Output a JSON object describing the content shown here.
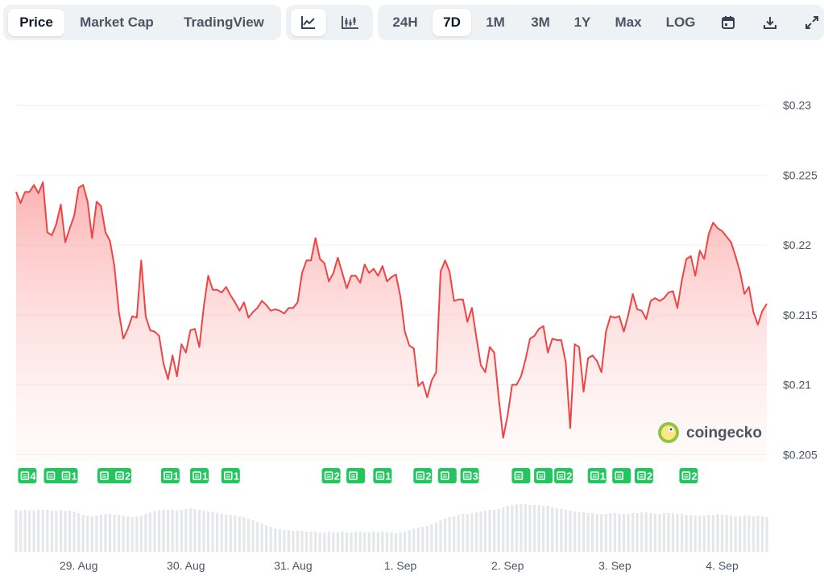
{
  "toolbar": {
    "metric_tabs": [
      "Price",
      "Market Cap",
      "TradingView"
    ],
    "active_metric": "Price",
    "chart_types": [
      "line-chart-icon",
      "candlestick-icon"
    ],
    "ranges": [
      "24H",
      "7D",
      "1M",
      "3M",
      "1Y",
      "Max",
      "LOG"
    ],
    "active_range": "7D",
    "actions": [
      "calendar-icon",
      "download-icon",
      "expand-icon"
    ]
  },
  "watermark": "coingecko",
  "colors": {
    "line": "#ef4444",
    "fill_top": "#fca5a5",
    "news": "#22c55e",
    "volume": "#e5e7eb",
    "grid": "#eef0f3"
  },
  "chart_data": {
    "type": "area",
    "title": "",
    "xlabel": "",
    "ylabel": "",
    "ylim": [
      0.2045,
      0.2335
    ],
    "y_ticks": [
      "$0.205",
      "$0.21",
      "$0.215",
      "$0.22",
      "$0.225",
      "$0.23"
    ],
    "y_tick_values": [
      0.205,
      0.21,
      0.215,
      0.22,
      0.225,
      0.23
    ],
    "x_range": [
      0,
      168
    ],
    "x_ticks": [
      "29. Aug",
      "30. Aug",
      "31. Aug",
      "1. Sep",
      "2. Sep",
      "3. Sep",
      "4. Sep"
    ],
    "x_tick_values": [
      14,
      38,
      62,
      86,
      110,
      134,
      158
    ],
    "grid": true,
    "series": [
      {
        "x": [
          0,
          1,
          2,
          3,
          4,
          5,
          6,
          7,
          8,
          9,
          10,
          11,
          12,
          13,
          14,
          15,
          16,
          17,
          18,
          19,
          20,
          21,
          22,
          23,
          24,
          25,
          26,
          27,
          28,
          29,
          30,
          31,
          32,
          33,
          34,
          35,
          36,
          37,
          38,
          39,
          40,
          41,
          42,
          43,
          44,
          45,
          46,
          47,
          48,
          49,
          50,
          51,
          52,
          53,
          54,
          55,
          56,
          57,
          58,
          59,
          60,
          61,
          62,
          63,
          64,
          65,
          66,
          67,
          68,
          69,
          70,
          71,
          72,
          73,
          74,
          75,
          76,
          77,
          78,
          79,
          80,
          81,
          82,
          83,
          84,
          85,
          86,
          87,
          88,
          89,
          90,
          91,
          92,
          93,
          94,
          95,
          96,
          97,
          98,
          99,
          100,
          101,
          102,
          103,
          104,
          105,
          106,
          107,
          108,
          109,
          110,
          111,
          112,
          113,
          114,
          115,
          116,
          117,
          118,
          119,
          120,
          121,
          122,
          123,
          124,
          125,
          126,
          127,
          128,
          129,
          130,
          131,
          132,
          133,
          134,
          135,
          136,
          137,
          138,
          139,
          140,
          141,
          142,
          143,
          144,
          145,
          146,
          147,
          148,
          149,
          150,
          151,
          152,
          153,
          154,
          155,
          156,
          157,
          158,
          159,
          160,
          161,
          162,
          163,
          164,
          165,
          166,
          167,
          168
        ],
        "values": [
          0.2238,
          0.223,
          0.2238,
          0.2238,
          0.2243,
          0.2237,
          0.2245,
          0.2209,
          0.2207,
          0.2215,
          0.2229,
          0.2202,
          0.2212,
          0.2221,
          0.2241,
          0.2243,
          0.2231,
          0.2205,
          0.2231,
          0.2228,
          0.2209,
          0.2203,
          0.2185,
          0.2152,
          0.2133,
          0.214,
          0.2149,
          0.2148,
          0.2189,
          0.2149,
          0.2139,
          0.2138,
          0.2135,
          0.2115,
          0.2104,
          0.2121,
          0.2106,
          0.2129,
          0.2123,
          0.2139,
          0.214,
          0.2127,
          0.2156,
          0.2178,
          0.2168,
          0.2168,
          0.2166,
          0.217,
          0.2164,
          0.2159,
          0.2153,
          0.2159,
          0.2148,
          0.2152,
          0.2155,
          0.216,
          0.2157,
          0.2153,
          0.2154,
          0.2153,
          0.2151,
          0.2155,
          0.2155,
          0.2159,
          0.218,
          0.2189,
          0.2189,
          0.2205,
          0.219,
          0.2187,
          0.2174,
          0.218,
          0.2191,
          0.218,
          0.2169,
          0.2178,
          0.2178,
          0.2173,
          0.2186,
          0.218,
          0.2183,
          0.2178,
          0.2185,
          0.2174,
          0.2177,
          0.2179,
          0.2163,
          0.2138,
          0.2128,
          0.2126,
          0.2099,
          0.2102,
          0.2091,
          0.2103,
          0.2109,
          0.2181,
          0.2189,
          0.2181,
          0.216,
          0.2161,
          0.2161,
          0.2145,
          0.2155,
          0.2134,
          0.2114,
          0.2109,
          0.2127,
          0.2123,
          0.2091,
          0.2062,
          0.2078,
          0.21,
          0.21,
          0.2106,
          0.2118,
          0.2133,
          0.2135,
          0.214,
          0.2142,
          0.2123,
          0.2133,
          0.2132,
          0.2132,
          0.2116,
          0.2069,
          0.2129,
          0.2127,
          0.2095,
          0.2119,
          0.2121,
          0.2117,
          0.2109,
          0.2138,
          0.2149,
          0.2148,
          0.2149,
          0.2138,
          0.215,
          0.2165,
          0.2154,
          0.2153,
          0.2147,
          0.216,
          0.2162,
          0.216,
          0.2162,
          0.2166,
          0.2167,
          0.2155,
          0.2175,
          0.219,
          0.2192,
          0.2178,
          0.2196,
          0.219,
          0.2208,
          0.2216,
          0.2212,
          0.221,
          0.2206,
          0.2202,
          0.2192,
          0.2181,
          0.2165,
          0.217,
          0.2152,
          0.2143,
          0.2153,
          0.2158
        ]
      }
    ],
    "volume": [
      52,
      51,
      52,
      51,
      51,
      52,
      52,
      52,
      51,
      51,
      52,
      51,
      51,
      50,
      48,
      46,
      45,
      44,
      45,
      46,
      47,
      47,
      46,
      46,
      45,
      44,
      43,
      44,
      45,
      47,
      49,
      51,
      52,
      52,
      52,
      52,
      51,
      52,
      53,
      54,
      53,
      52,
      51,
      50,
      49,
      48,
      47,
      46,
      46,
      45,
      44,
      43,
      41,
      39,
      37,
      35,
      33,
      31,
      29,
      28,
      27,
      27,
      26,
      26,
      26,
      25,
      25,
      25,
      24,
      24,
      25,
      24,
      24,
      25,
      24,
      24,
      25,
      25,
      24,
      24,
      25,
      24,
      25,
      24,
      24,
      23,
      24,
      25,
      27,
      29,
      30,
      31,
      32,
      34,
      36,
      39,
      41,
      43,
      44,
      46,
      47,
      47,
      48,
      49,
      50,
      51,
      52,
      52,
      53,
      55,
      57,
      58,
      59,
      59,
      59,
      58,
      58,
      58,
      57,
      57,
      55,
      54,
      53,
      52,
      51,
      50,
      49,
      49,
      48,
      48,
      47,
      47,
      47,
      48,
      48,
      47,
      47,
      47,
      48,
      48,
      49,
      49,
      48,
      47,
      47,
      48,
      48,
      48,
      47,
      47,
      46,
      46,
      45,
      45,
      45,
      46,
      46,
      47,
      46,
      46,
      45,
      44,
      44,
      45,
      45,
      44,
      45,
      44,
      43
    ],
    "news": [
      {
        "x": 2.5,
        "labels": [
          "4"
        ]
      },
      {
        "x": 10,
        "labels": [
          "",
          "1"
        ]
      },
      {
        "x": 22,
        "labels": [
          "",
          "2"
        ]
      },
      {
        "x": 34.5,
        "labels": [
          "1"
        ]
      },
      {
        "x": 41,
        "labels": [
          "1"
        ]
      },
      {
        "x": 48,
        "labels": [
          "1"
        ]
      },
      {
        "x": 70.5,
        "labels": [
          "2"
        ]
      },
      {
        "x": 76,
        "labels": [
          ""
        ]
      },
      {
        "x": 82,
        "labels": [
          "1"
        ]
      },
      {
        "x": 91,
        "labels": [
          "2"
        ]
      },
      {
        "x": 96.5,
        "labels": [
          ""
        ]
      },
      {
        "x": 101.5,
        "labels": [
          "3"
        ]
      },
      {
        "x": 113,
        "labels": [
          ""
        ]
      },
      {
        "x": 118,
        "labels": [
          ""
        ]
      },
      {
        "x": 122.5,
        "labels": [
          "2"
        ]
      },
      {
        "x": 130,
        "labels": [
          "1"
        ]
      },
      {
        "x": 135.5,
        "labels": [
          ""
        ]
      },
      {
        "x": 140.5,
        "labels": [
          "2"
        ]
      },
      {
        "x": 150.5,
        "labels": [
          "2"
        ]
      }
    ]
  }
}
